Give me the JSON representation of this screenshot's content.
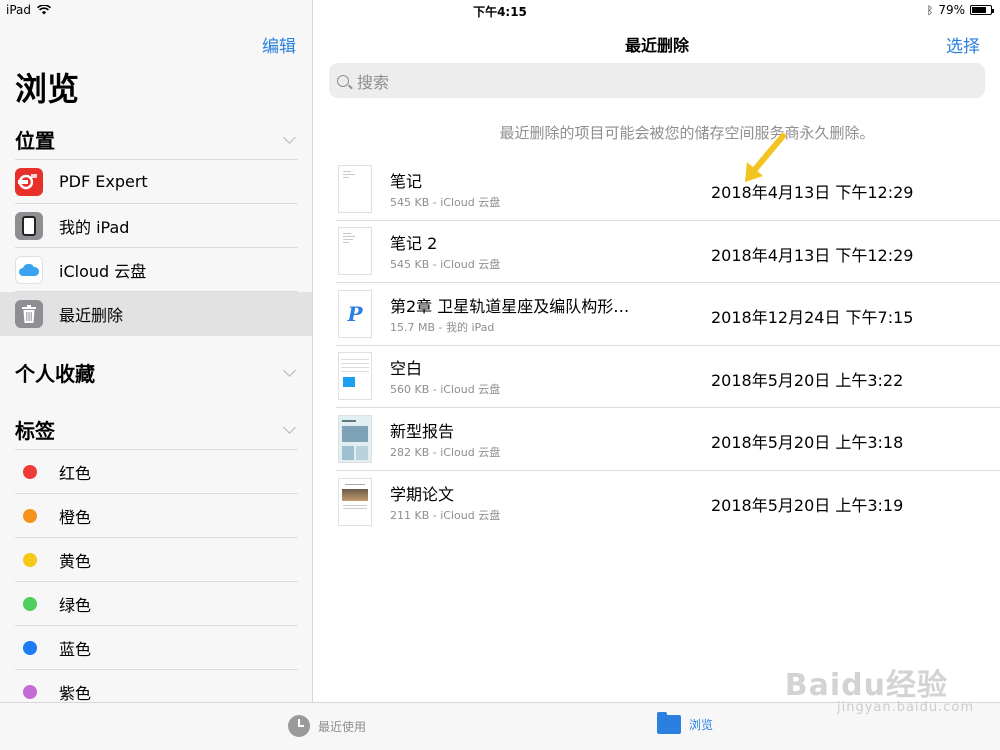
{
  "status_bar": {
    "device": "iPad",
    "time": "下午4:15",
    "battery": "79%",
    "battery_level": 0.79
  },
  "sidebar": {
    "edit_label": "编辑",
    "title": "浏览",
    "locations": {
      "header": "位置",
      "items": [
        {
          "label": "PDF Expert",
          "icon": "pdf-expert-icon"
        },
        {
          "label": "我的 iPad",
          "icon": "ipad-icon"
        },
        {
          "label": "iCloud 云盘",
          "icon": "icloud-icon"
        },
        {
          "label": "最近删除",
          "icon": "trash-icon",
          "selected": true
        }
      ]
    },
    "favorites": {
      "header": "个人收藏"
    },
    "tags": {
      "header": "标签",
      "items": [
        {
          "label": "红色",
          "color": "#ee3b36"
        },
        {
          "label": "橙色",
          "color": "#f5921e"
        },
        {
          "label": "黄色",
          "color": "#f7c81b"
        },
        {
          "label": "绿色",
          "color": "#4ccf5c"
        },
        {
          "label": "蓝色",
          "color": "#1b7cf5"
        },
        {
          "label": "紫色",
          "color": "#c46bd8"
        }
      ]
    }
  },
  "main": {
    "title": "最近删除",
    "select_label": "选择",
    "search_placeholder": "搜索",
    "notice": "最近删除的项目可能会被您的储存空间服务商永久删除。",
    "files": [
      {
        "name": "笔记",
        "meta": "545 KB - iCloud 云盘",
        "date": "2018年4月13日 下午12:29",
        "thumb": "note"
      },
      {
        "name": "笔记 2",
        "meta": "545 KB - iCloud 云盘",
        "date": "2018年4月13日 下午12:29",
        "thumb": "note"
      },
      {
        "name": "第2章 卫星轨道星座及编队构形…",
        "meta": "15.7 MB - 我的 iPad",
        "date": "2018年12月24日 下午7:15",
        "thumb": "pages"
      },
      {
        "name": "空白",
        "meta": "560 KB - iCloud 云盘",
        "date": "2018年5月20日 上午3:22",
        "thumb": "sheet"
      },
      {
        "name": "新型报告",
        "meta": "282 KB - iCloud 云盘",
        "date": "2018年5月20日 上午3:18",
        "thumb": "report"
      },
      {
        "name": "学期论文",
        "meta": "211 KB - iCloud 云盘",
        "date": "2018年5月20日 上午3:19",
        "thumb": "paper"
      }
    ]
  },
  "tabbar": {
    "recent_label": "最近使用",
    "browse_label": "浏览"
  },
  "watermark": {
    "line1": "Baidu经验",
    "line2": "jingyan.baidu.com"
  }
}
